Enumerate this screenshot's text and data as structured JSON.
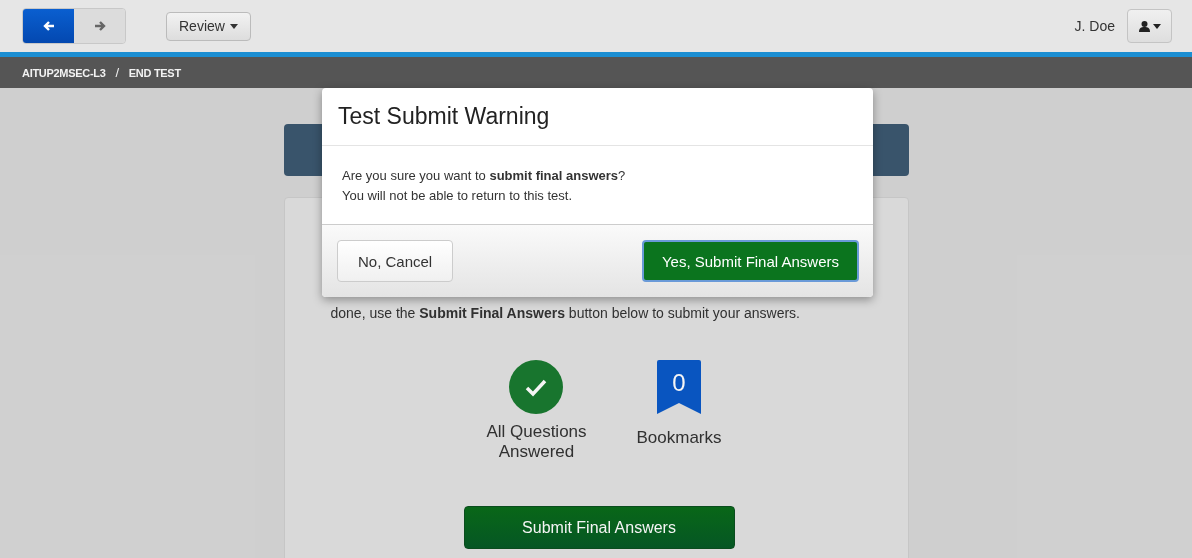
{
  "toolbar": {
    "nav_buttons": [
      {
        "kind": "back",
        "selected": true
      },
      {
        "kind": "forward",
        "selected": false
      }
    ],
    "review_menu": {
      "label": "Review"
    },
    "user": {
      "name": "J. Doe"
    }
  },
  "breadcrumb": {
    "separator": "/",
    "items": [
      "AITUP2MSEC-L3",
      "END TEST"
    ]
  },
  "card": {
    "instructions": "done, use the **Submit Final Answers** button below to submit your answers.",
    "stats": [
      {
        "kind": "answered",
        "label": "All Questions Answered"
      },
      {
        "kind": "bookmarks",
        "count": "0",
        "label": "Bookmarks"
      }
    ],
    "submit_button": "Submit Final Answers"
  },
  "modal": {
    "title": "Test Submit Warning",
    "message": [
      "Are you sure you want to **submit final answers**?",
      "You will not be able to return to this test."
    ],
    "cancel_button": "No, Cancel",
    "confirm_button": "Yes, Submit Final Answers"
  }
}
